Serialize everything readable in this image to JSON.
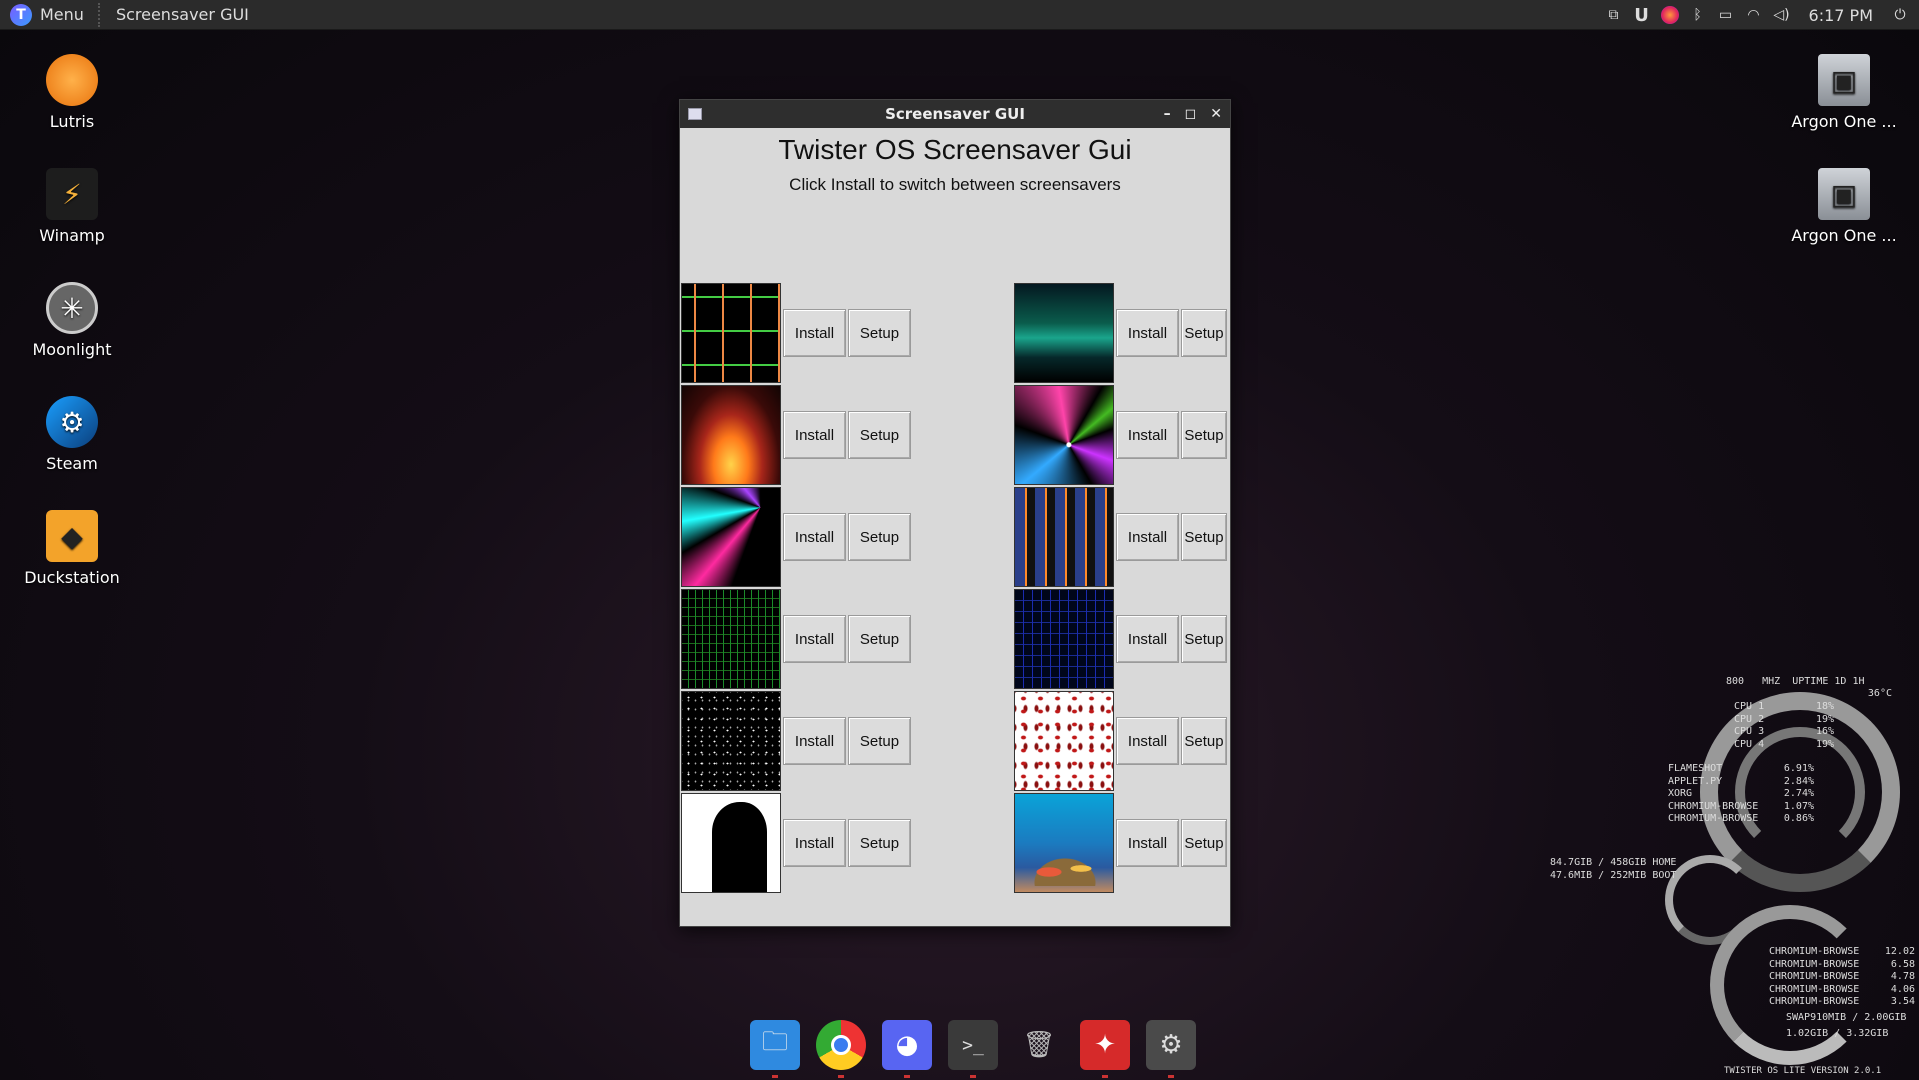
{
  "top_panel": {
    "menu_label": "Menu",
    "active_window": "Screensaver GUI",
    "clock": "6:17 PM",
    "tray_icons": [
      "screenshot-icon",
      "u-icon",
      "firefox-icon",
      "bluetooth-icon",
      "battery-icon",
      "wifi-icon",
      "volume-icon",
      "power-icon"
    ]
  },
  "desktop_left": [
    {
      "label": "Lutris",
      "icon": "lutris-icon"
    },
    {
      "label": "Winamp",
      "icon": "winamp-icon"
    },
    {
      "label": "Moonlight",
      "icon": "moonlight-icon"
    },
    {
      "label": "Steam",
      "icon": "steam-icon"
    },
    {
      "label": "Duckstation",
      "icon": "duckstation-icon"
    }
  ],
  "desktop_right": [
    {
      "label": "Argon One ...",
      "icon": "argon-config-icon"
    },
    {
      "label": "Argon One ...",
      "icon": "argon-remove-icon"
    }
  ],
  "window": {
    "title": "Screensaver GUI",
    "heading": "Twister OS Screensaver Gui",
    "subtitle": "Click Install to switch between screensavers",
    "install_label": "Install",
    "setup_label": "Setup"
  },
  "screensavers_left": [
    "pipes",
    "fire",
    "laser",
    "matrix-grid",
    "starfield",
    "silhouette"
  ],
  "screensavers_right": [
    "aurora",
    "swirl",
    "dashboard",
    "blue-grid",
    "fish",
    "aquarium"
  ],
  "conky": {
    "freq": "800",
    "freq_unit": "MHZ",
    "uptime": "UPTIME 1D 1H",
    "temp": "36°C",
    "cpus": [
      {
        "label": "CPU 1",
        "value": "18%"
      },
      {
        "label": "CPU 2",
        "value": "19%"
      },
      {
        "label": "CPU 3",
        "value": "16%"
      },
      {
        "label": "CPU 4",
        "value": "19%"
      }
    ],
    "processes": [
      {
        "name": "FLAMESHOT",
        "value": "6.91%"
      },
      {
        "name": "APPLET.PY",
        "value": "2.84%"
      },
      {
        "name": "XORG",
        "value": "2.74%"
      },
      {
        "name": "CHROMIUM-BROWSE",
        "value": "1.07%"
      },
      {
        "name": "CHROMIUM-BROWSE",
        "value": "0.86%"
      }
    ],
    "disk_home": "84.7GIB / 458GIB HOME",
    "disk_boot": "47.6MIB / 252MIB BOOT",
    "mem_processes": [
      {
        "name": "CHROMIUM-BROWSE",
        "value": "12.02"
      },
      {
        "name": "CHROMIUM-BROWSE",
        "value": "6.58"
      },
      {
        "name": "CHROMIUM-BROWSE",
        "value": "4.78"
      },
      {
        "name": "CHROMIUM-BROWSE",
        "value": "4.06"
      },
      {
        "name": "CHROMIUM-BROWSE",
        "value": "3.54"
      }
    ],
    "swap": "SWAP910MIB / 2.00GIB",
    "ram": "1.02GIB / 3.32GIB",
    "version": "TWISTER OS LITE VERSION 2.0.1"
  },
  "dock": [
    "files-icon",
    "chrome-icon",
    "discord-icon",
    "terminal-icon",
    "trash-icon",
    "pdf-reader-icon",
    "settings-icon"
  ]
}
